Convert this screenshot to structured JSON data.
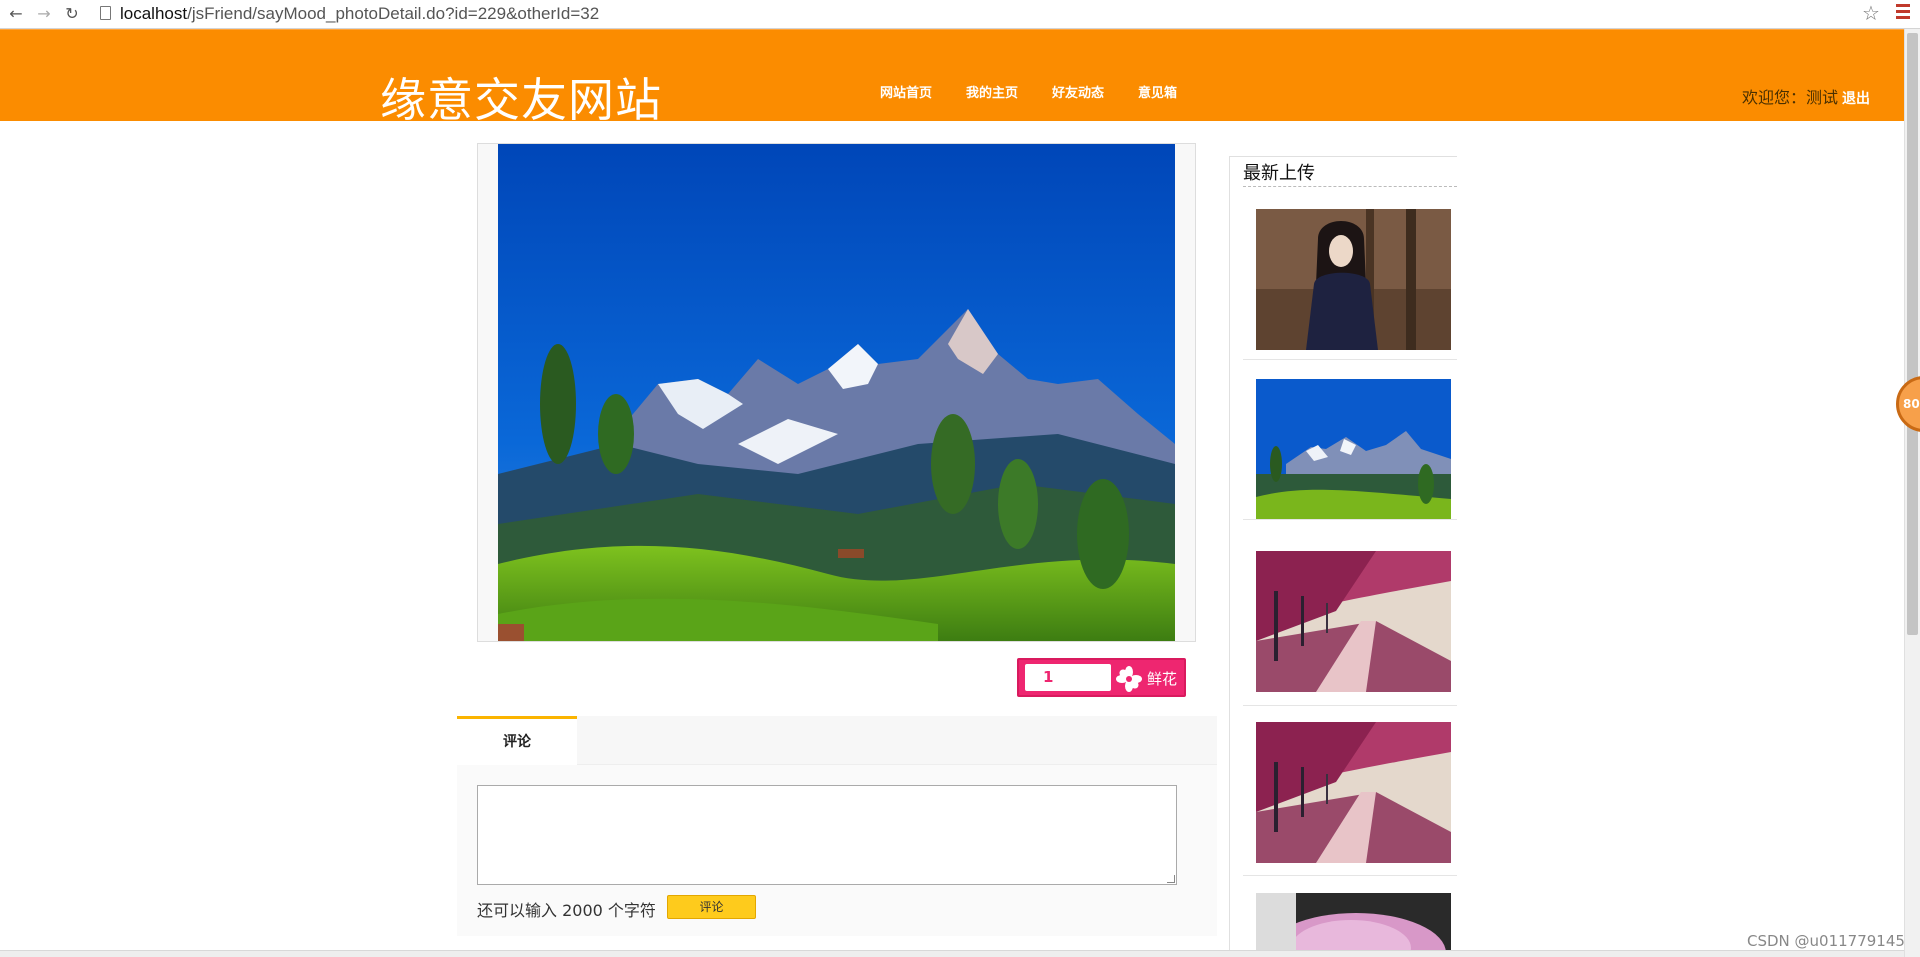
{
  "browser": {
    "url_host": "localhost",
    "url_path": "/jsFriend/sayMood_photoDetail.do?id=229&otherId=32"
  },
  "header": {
    "logo": "缘意交友网站",
    "nav": [
      "网站首页",
      "我的主页",
      "好友动态",
      "意见箱"
    ],
    "welcome": "欢迎您：测试",
    "logout": "退出"
  },
  "flower": {
    "count": "1",
    "label": "鲜花"
  },
  "comments": {
    "tab_label": "评论",
    "hint": "还可以输入 2000 个字符",
    "submit_label": "评论"
  },
  "sidebar": {
    "title": "最新上传"
  },
  "floating_badge": "80",
  "watermark": "CSDN @u011779145",
  "colors": {
    "header_bg": "#fb8c00",
    "flower_btn": "#ee2670",
    "comment_btn": "#fecb1c",
    "tab_accent": "#fbb400"
  }
}
